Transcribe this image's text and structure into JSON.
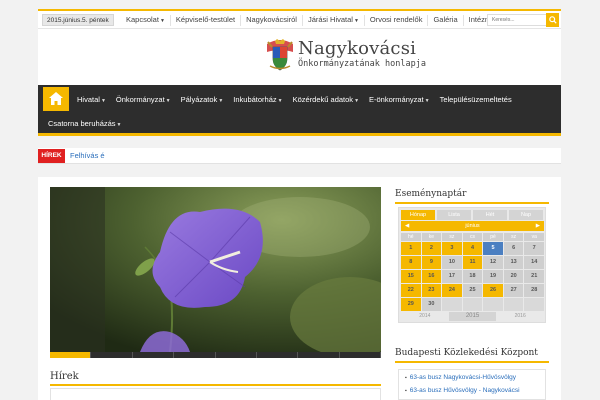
{
  "topbar": {
    "date": "2015.június.5. péntek",
    "nav": [
      {
        "label": "Kapcsolat",
        "dropdown": true
      },
      {
        "label": "Képviselő-testület",
        "dropdown": false
      },
      {
        "label": "Nagykovácsiról",
        "dropdown": false
      },
      {
        "label": "Járási Hivatal",
        "dropdown": true
      },
      {
        "label": "Orvosi rendelők",
        "dropdown": false
      },
      {
        "label": "Galéria",
        "dropdown": false
      },
      {
        "label": "Intézmények",
        "dropdown": false
      }
    ],
    "search_placeholder": "Keresés..."
  },
  "header": {
    "title": "Nagykovácsi",
    "subtitle": "Önkormányzatának honlapja"
  },
  "mainnav": {
    "row1": [
      "Hivatal",
      "Önkormányzat",
      "Pályázatok",
      "Inkubátorház",
      "Közérdekű adatok",
      "E-önkormányzat",
      "Településüzemeltetés"
    ],
    "row1_dropdown": [
      true,
      true,
      true,
      true,
      true,
      true,
      false
    ],
    "row2": [
      "Csatorna beruházás"
    ],
    "row2_dropdown": [
      true
    ]
  },
  "ticker": {
    "label": "HÍREK",
    "text": "Felhívás é"
  },
  "main": {
    "news_title": "Hírek"
  },
  "sidebar": {
    "calendar_title": "Eseménynaptár",
    "calendar": {
      "tabs": [
        "Hónap",
        "Lista",
        "Hét",
        "Nap"
      ],
      "month": "június",
      "weekdays": [
        "hé",
        "ke",
        "sz",
        "cs",
        "pé",
        "sz",
        "va"
      ],
      "days": [
        {
          "d": "1",
          "s": "y"
        },
        {
          "d": "2",
          "s": "y"
        },
        {
          "d": "3",
          "s": "y"
        },
        {
          "d": "4",
          "s": "y"
        },
        {
          "d": "5",
          "s": "b"
        },
        {
          "d": "6",
          "s": ""
        },
        {
          "d": "7",
          "s": ""
        },
        {
          "d": "8",
          "s": "y"
        },
        {
          "d": "9",
          "s": "y"
        },
        {
          "d": "10",
          "s": ""
        },
        {
          "d": "11",
          "s": "y"
        },
        {
          "d": "12",
          "s": ""
        },
        {
          "d": "13",
          "s": ""
        },
        {
          "d": "14",
          "s": ""
        },
        {
          "d": "15",
          "s": "y"
        },
        {
          "d": "16",
          "s": "y"
        },
        {
          "d": "17",
          "s": ""
        },
        {
          "d": "18",
          "s": ""
        },
        {
          "d": "19",
          "s": ""
        },
        {
          "d": "20",
          "s": ""
        },
        {
          "d": "21",
          "s": ""
        },
        {
          "d": "22",
          "s": "y"
        },
        {
          "d": "23",
          "s": "y"
        },
        {
          "d": "24",
          "s": "y"
        },
        {
          "d": "25",
          "s": ""
        },
        {
          "d": "26",
          "s": "y"
        },
        {
          "d": "27",
          "s": ""
        },
        {
          "d": "28",
          "s": ""
        },
        {
          "d": "29",
          "s": "y"
        },
        {
          "d": "30",
          "s": ""
        },
        {
          "d": "",
          "s": "e"
        },
        {
          "d": "",
          "s": "e"
        },
        {
          "d": "",
          "s": "e"
        },
        {
          "d": "",
          "s": "e"
        },
        {
          "d": "",
          "s": "e"
        }
      ],
      "years": [
        "2014",
        "2015",
        "2016"
      ]
    },
    "bkk_title": "Budapesti Közlekedési Központ",
    "bkk_items": [
      "63-as busz Nagykovácsi-Hűvösvölgy",
      "63-as busz Hűvösvölgy - Nagykovácsi"
    ]
  },
  "colors": {
    "accent": "#f5b800",
    "nav_bg": "#2d2d2d",
    "ticker_label": "#e02020",
    "link": "#2a6ebb"
  },
  "icons": {
    "home": "home-icon",
    "search": "search-icon",
    "caret": "caret-down-icon"
  }
}
